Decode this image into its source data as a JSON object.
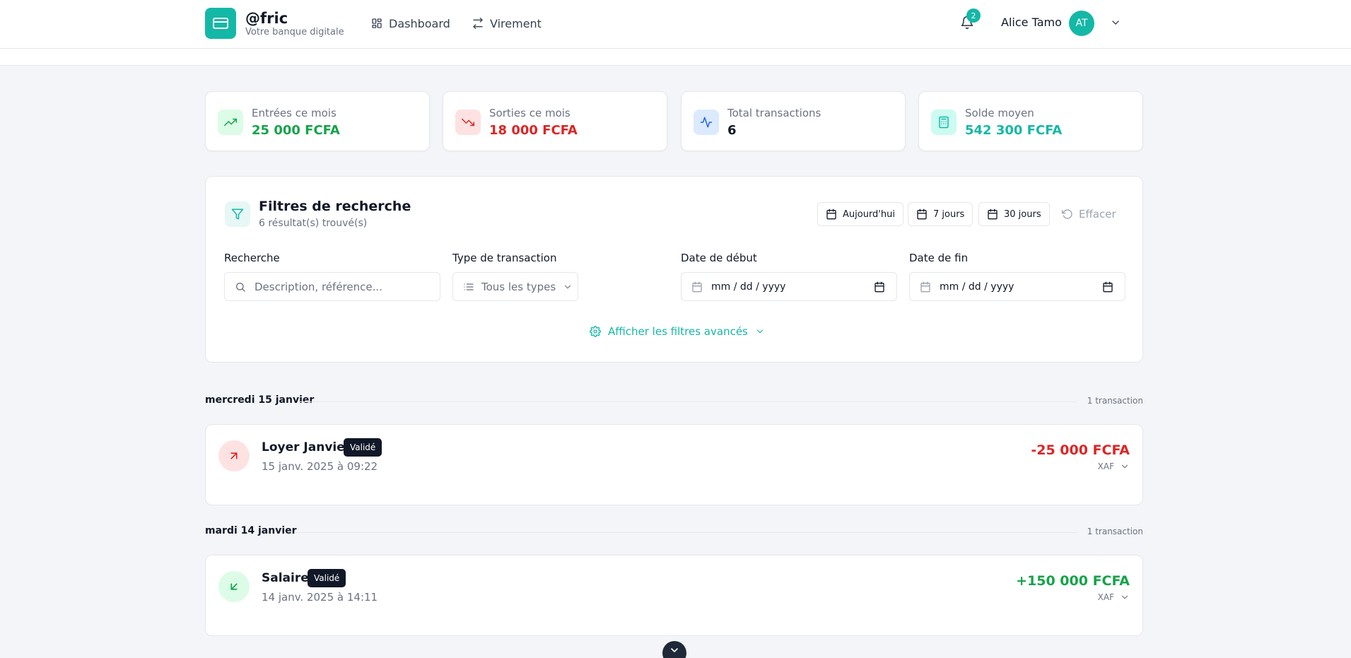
{
  "header": {
    "brand_name": "@fric",
    "brand_tagline": "Votre banque digitale",
    "nav": [
      {
        "label": "Dashboard",
        "icon": "grid-icon"
      },
      {
        "label": "Virement",
        "icon": "transfer-arrows-icon"
      }
    ],
    "notifications_count": "2",
    "user_name": "Alice Tamo",
    "user_initials": "AT"
  },
  "stats": [
    {
      "label": "Entrées ce mois",
      "value": "25 000 FCFA",
      "icon": "trending-up-icon",
      "color": "#16a34a"
    },
    {
      "label": "Sorties ce mois",
      "value": "18 000 FCFA",
      "icon": "trending-down-icon",
      "color": "#dc2626"
    },
    {
      "label": "Total transactions",
      "value": "6",
      "icon": "activity-icon",
      "color": "#111827"
    },
    {
      "label": "Solde moyen",
      "value": "542 300 FCFA",
      "icon": "calculator-icon",
      "color": "#14b8a6"
    }
  ],
  "filters": {
    "title": "Filtres de recherche",
    "results": "6 résultat(s) trouvé(s)",
    "quick": [
      "Aujourd'hui",
      "7 jours",
      "30 jours"
    ],
    "clear_label": "Effacer",
    "search_label": "Recherche",
    "search_placeholder": "Description, référence...",
    "type_label": "Type de transaction",
    "type_value": "Tous les types",
    "start_label": "Date de début",
    "start_value": "mm / dd / yyyy",
    "end_label": "Date de fin",
    "end_value": "mm / dd / yyyy",
    "advanced_label": "Afficher les filtres avancés"
  },
  "groups": [
    {
      "date": "mercredi 15 janvier",
      "count": "1 transaction",
      "tx": {
        "title": "Loyer Janvier",
        "status": "Validé",
        "datetime": "15 janv. 2025 à 09:22",
        "amount": "-25 000 FCFA",
        "currency": "XAF",
        "direction": "out"
      }
    },
    {
      "date": "mardi 14 janvier",
      "count": "1 transaction",
      "tx": {
        "title": "Salaire",
        "status": "Validé",
        "datetime": "14 janv. 2025 à 14:11",
        "amount": "+150 000 FCFA",
        "currency": "XAF",
        "direction": "in"
      }
    }
  ],
  "colors": {
    "accent": "#14b8a6",
    "positive": "#16a34a",
    "negative": "#dc2626"
  }
}
